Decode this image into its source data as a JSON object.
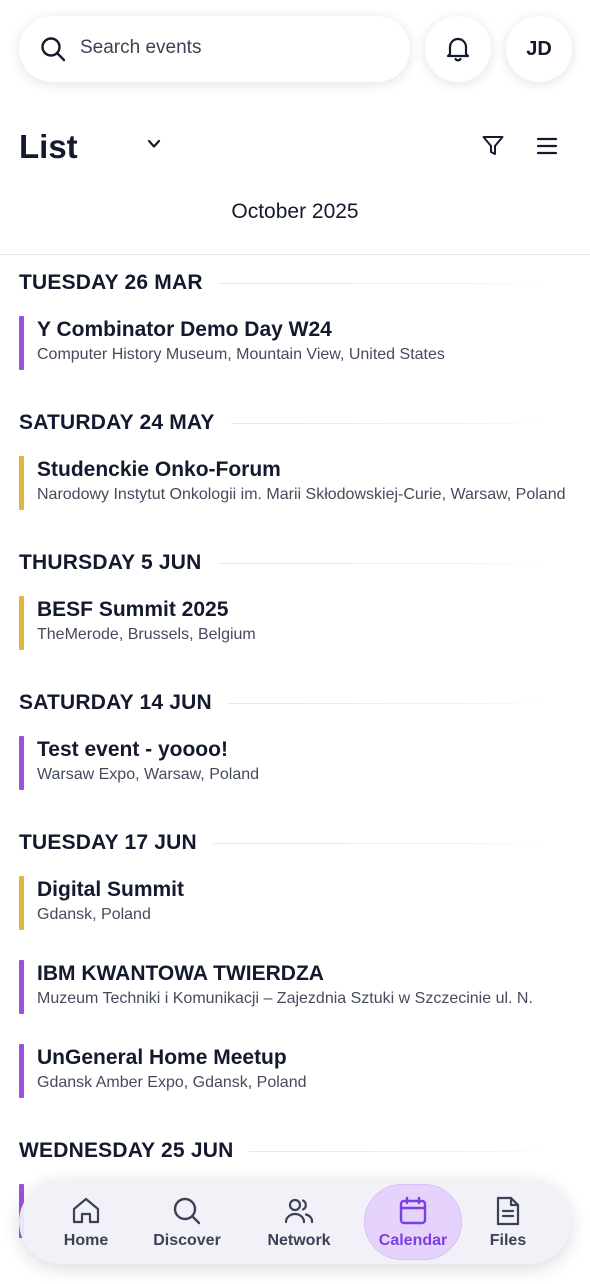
{
  "search": {
    "placeholder": "Search events"
  },
  "user": {
    "initials": "JD"
  },
  "toolbar": {
    "view_label": "List"
  },
  "calendar": {
    "month_label": "October 2025"
  },
  "colors": {
    "purple": "#9b51e0",
    "yellow": "#e2b53c",
    "accent": "#7b3fe4"
  },
  "days": [
    {
      "label": "TUESDAY 26 MAR",
      "events": [
        {
          "title": "Y Combinator Demo Day W24",
          "location": "Computer History Museum, Mountain View, United States",
          "color": "purple"
        }
      ]
    },
    {
      "label": "SATURDAY 24 MAY",
      "events": [
        {
          "title": "Studenckie Onko-Forum",
          "location": "Narodowy Instytut Onkologii im. Marii Skłodowskiej-Curie, Warsaw, Poland",
          "color": "yellow"
        }
      ]
    },
    {
      "label": "THURSDAY 5 JUN",
      "events": [
        {
          "title": "BESF Summit 2025",
          "location": "TheMerode, Brussels, Belgium",
          "color": "yellow"
        }
      ]
    },
    {
      "label": "SATURDAY 14 JUN",
      "events": [
        {
          "title": "Test event - yoooo!",
          "location": "Warsaw Expo, Warsaw, Poland",
          "color": "purple"
        }
      ]
    },
    {
      "label": "TUESDAY 17 JUN",
      "events": [
        {
          "title": "Digital Summit",
          "location": "Gdansk, Poland",
          "color": "yellow"
        },
        {
          "title": "IBM KWANTOWA TWIERDZA",
          "location": "Muzeum Techniki i Komunikacji – Zajezdnia Sztuki w Szczecinie  ul. N.",
          "color": "purple"
        },
        {
          "title": "UnGeneral Home Meetup",
          "location": "Gdansk Amber Expo, Gdansk, Poland",
          "color": "purple"
        }
      ]
    },
    {
      "label": "WEDNESDAY 25 JUN",
      "events": [
        {
          "title": "",
          "location": "",
          "color": "purple"
        }
      ]
    }
  ],
  "nav": {
    "items": [
      {
        "label": "Home",
        "icon": "home-icon"
      },
      {
        "label": "Discover",
        "icon": "search-icon"
      },
      {
        "label": "Network",
        "icon": "users-icon"
      },
      {
        "label": "Calendar",
        "icon": "calendar-icon",
        "active": true
      },
      {
        "label": "Files",
        "icon": "file-icon"
      }
    ]
  }
}
